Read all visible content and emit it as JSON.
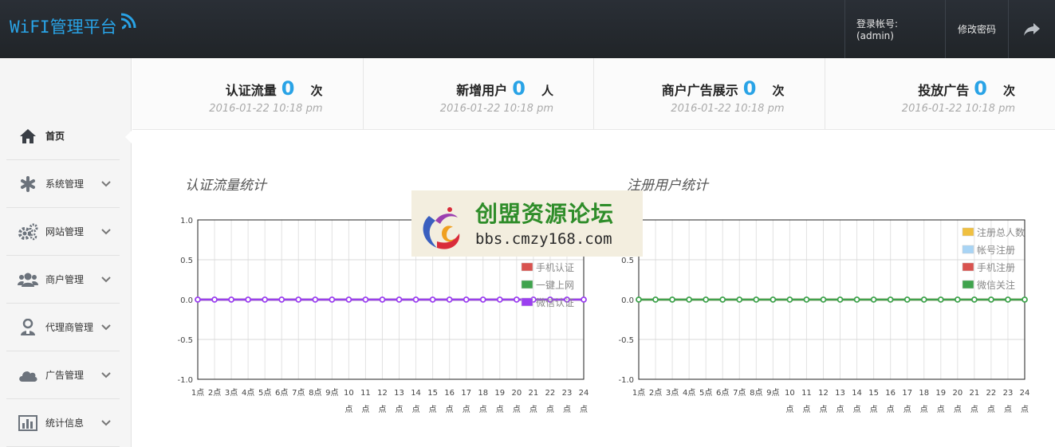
{
  "header": {
    "logo": "WiFI管理平台",
    "account": "登录帐号:(admin)",
    "change_password": "修改密码",
    "exit_icon": "share-arrow-icon"
  },
  "sidebar": {
    "items": [
      {
        "label": "首页",
        "icon": "home-icon",
        "active": true
      },
      {
        "label": "系统管理",
        "icon": "asterisk-icon"
      },
      {
        "label": "网站管理",
        "icon": "gears-icon"
      },
      {
        "label": "商户管理",
        "icon": "users-icon"
      },
      {
        "label": "代理商管理",
        "icon": "agent-icon"
      },
      {
        "label": "广告管理",
        "icon": "cloud-icon"
      },
      {
        "label": "统计信息",
        "icon": "bar-chart-icon"
      }
    ]
  },
  "stats": [
    {
      "title": "认证流量",
      "value": "0",
      "unit": "次",
      "date": "2016-01-22 10:18 pm"
    },
    {
      "title": "新增用户",
      "value": "0",
      "unit": "人",
      "date": "2016-01-22 10:18 pm"
    },
    {
      "title": "商户广告展示",
      "value": "0",
      "unit": "次",
      "date": "2016-01-22 10:18 pm"
    },
    {
      "title": "投放广告",
      "value": "0",
      "unit": "次",
      "date": "2016-01-22 10:18 pm"
    }
  ],
  "watermark": {
    "name": "创盟资源论坛",
    "url": "bbs.cmzy168.com"
  },
  "chart_data": [
    {
      "type": "line",
      "title": "认证流量统计",
      "x": [
        "1点",
        "2点",
        "3点",
        "4点",
        "5点",
        "6点",
        "7点",
        "8点",
        "9点",
        "10点",
        "11点",
        "12点",
        "13点",
        "14点",
        "15点",
        "16点",
        "17点",
        "18点",
        "19点",
        "20点",
        "21点",
        "22点",
        "23点",
        "24点"
      ],
      "ylim": [
        -1.0,
        1.0
      ],
      "yticks": [
        "1.0",
        "0.5",
        "0.0",
        "-0.5",
        "-1.0"
      ],
      "legend_position": "top-right",
      "series": [
        {
          "name": "手机认证",
          "color": "#d9534f",
          "values": [
            0,
            0,
            0,
            0,
            0,
            0,
            0,
            0,
            0,
            0,
            0,
            0,
            0,
            0,
            0,
            0,
            0,
            0,
            0,
            0,
            0,
            0,
            0,
            0
          ]
        },
        {
          "name": "一键上网",
          "color": "#3fa34d",
          "values": [
            0,
            0,
            0,
            0,
            0,
            0,
            0,
            0,
            0,
            0,
            0,
            0,
            0,
            0,
            0,
            0,
            0,
            0,
            0,
            0,
            0,
            0,
            0,
            0
          ]
        },
        {
          "name": "微信认证",
          "color": "#9b3ff0",
          "values": [
            0,
            0,
            0,
            0,
            0,
            0,
            0,
            0,
            0,
            0,
            0,
            0,
            0,
            0,
            0,
            0,
            0,
            0,
            0,
            0,
            0,
            0,
            0,
            0
          ]
        }
      ]
    },
    {
      "type": "line",
      "title": "注册用户统计",
      "x": [
        "1点",
        "2点",
        "3点",
        "4点",
        "5点",
        "6点",
        "7点",
        "8点",
        "9点",
        "10点",
        "11点",
        "12点",
        "13点",
        "14点",
        "15点",
        "16点",
        "17点",
        "18点",
        "19点",
        "20点",
        "21点",
        "22点",
        "23点",
        "24点"
      ],
      "ylim": [
        -1.0,
        1.0
      ],
      "yticks": [
        "1.0",
        "0.5",
        "0.0",
        "-0.5",
        "-1.0"
      ],
      "legend_position": "top-right",
      "series": [
        {
          "name": "注册总人数",
          "color": "#f0c040",
          "values": [
            0,
            0,
            0,
            0,
            0,
            0,
            0,
            0,
            0,
            0,
            0,
            0,
            0,
            0,
            0,
            0,
            0,
            0,
            0,
            0,
            0,
            0,
            0,
            0
          ]
        },
        {
          "name": "帐号注册",
          "color": "#a8d4f5",
          "values": [
            0,
            0,
            0,
            0,
            0,
            0,
            0,
            0,
            0,
            0,
            0,
            0,
            0,
            0,
            0,
            0,
            0,
            0,
            0,
            0,
            0,
            0,
            0,
            0
          ]
        },
        {
          "name": "手机注册",
          "color": "#d9534f",
          "values": [
            0,
            0,
            0,
            0,
            0,
            0,
            0,
            0,
            0,
            0,
            0,
            0,
            0,
            0,
            0,
            0,
            0,
            0,
            0,
            0,
            0,
            0,
            0,
            0
          ]
        },
        {
          "name": "微信关注",
          "color": "#3fa34d",
          "values": [
            0,
            0,
            0,
            0,
            0,
            0,
            0,
            0,
            0,
            0,
            0,
            0,
            0,
            0,
            0,
            0,
            0,
            0,
            0,
            0,
            0,
            0,
            0,
            0
          ]
        }
      ]
    }
  ]
}
